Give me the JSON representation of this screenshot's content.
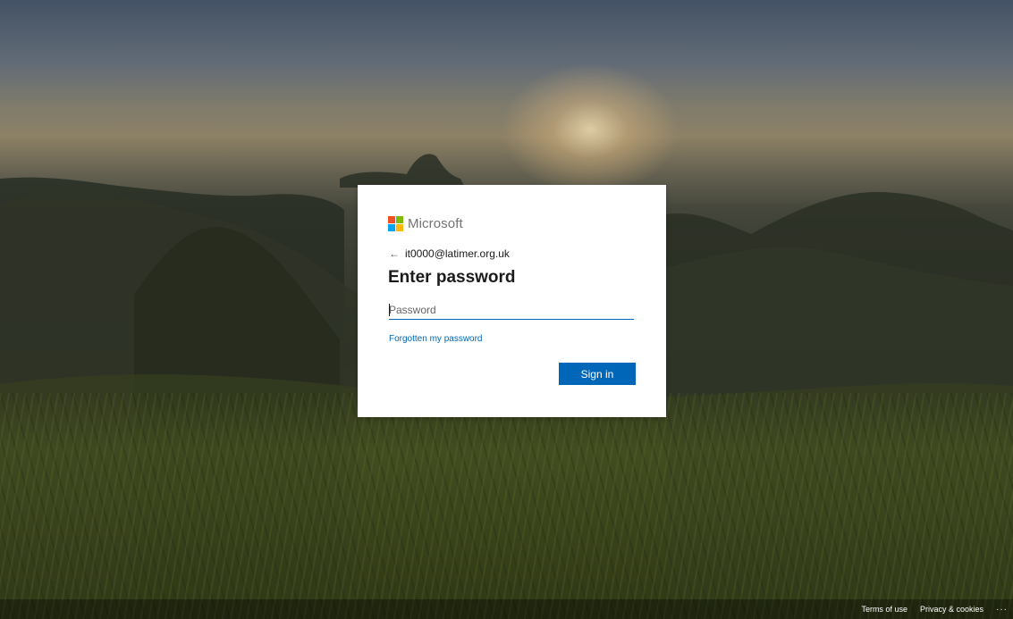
{
  "brand": {
    "name": "Microsoft",
    "logo_colors": [
      "#f25022",
      "#7fba00",
      "#00a4ef",
      "#ffb900"
    ]
  },
  "identity": {
    "email": "it0000@latimer.org.uk",
    "back_icon": "←"
  },
  "form": {
    "title": "Enter password",
    "password_placeholder": "Password",
    "password_value": "",
    "forgot_link": "Forgotten my password",
    "signin_label": "Sign in"
  },
  "footer": {
    "terms": "Terms of use",
    "privacy": "Privacy & cookies",
    "more": "···"
  },
  "colors": {
    "accent": "#0067b8",
    "card_bg": "#ffffff"
  }
}
